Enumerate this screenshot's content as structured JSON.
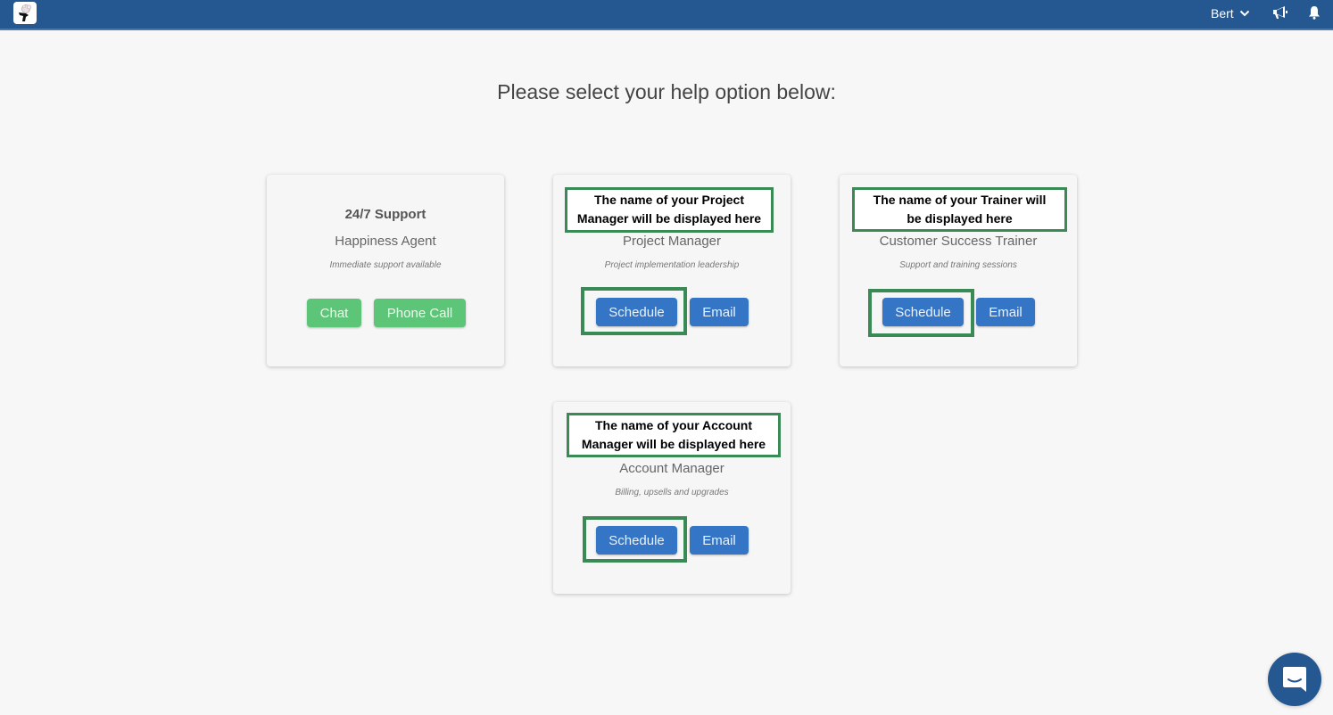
{
  "topbar": {
    "logo_icon": "app-logo-icon",
    "user_name": "Bert",
    "user_menu_icon": "chevron-down-icon",
    "announcements_icon": "megaphone-icon",
    "notifications_icon": "bell-icon",
    "background_color": "#255891"
  },
  "page": {
    "title": "Please select your help option below:"
  },
  "cards": [
    {
      "heading": "24/7 Support",
      "role": "Happiness Agent",
      "description": "Immediate support available",
      "buttons": [
        {
          "label": "Chat",
          "color": "#5cc577"
        },
        {
          "label": "Phone Call",
          "color": "#5cc577"
        }
      ]
    },
    {
      "name_placeholder": "The name of your Project Manager will be displayed here",
      "name_line1": "The name of your Project",
      "name_line2": "Manager will be displayed here",
      "role": "Project Manager",
      "description": "Project implementation leadership",
      "buttons": [
        {
          "label": "Schedule",
          "color": "#3575c6",
          "highlighted": true
        },
        {
          "label": "Email",
          "color": "#3575c6"
        }
      ]
    },
    {
      "name_placeholder": "The name of your Trainer will be displayed here",
      "name_line1": "The name of your Trainer will",
      "name_line2": "be displayed here",
      "role": "Customer Success Trainer",
      "description": "Support and training sessions",
      "buttons": [
        {
          "label": "Schedule",
          "color": "#3575c6",
          "highlighted": true
        },
        {
          "label": "Email",
          "color": "#3575c6"
        }
      ]
    },
    {
      "name_placeholder": "The name of your Account Manager will be displayed here",
      "name_line1": "The name of your Account",
      "name_line2": "Manager will be displayed here",
      "role": "Account Manager",
      "description": "Billing, upsells and upgrades",
      "buttons": [
        {
          "label": "Schedule",
          "color": "#3575c6",
          "highlighted": true
        },
        {
          "label": "Email",
          "color": "#3575c6"
        }
      ]
    }
  ],
  "annotation_color": "#3a8a55",
  "chat_widget": {
    "icon": "chat-bubble-icon",
    "color": "#255891"
  }
}
